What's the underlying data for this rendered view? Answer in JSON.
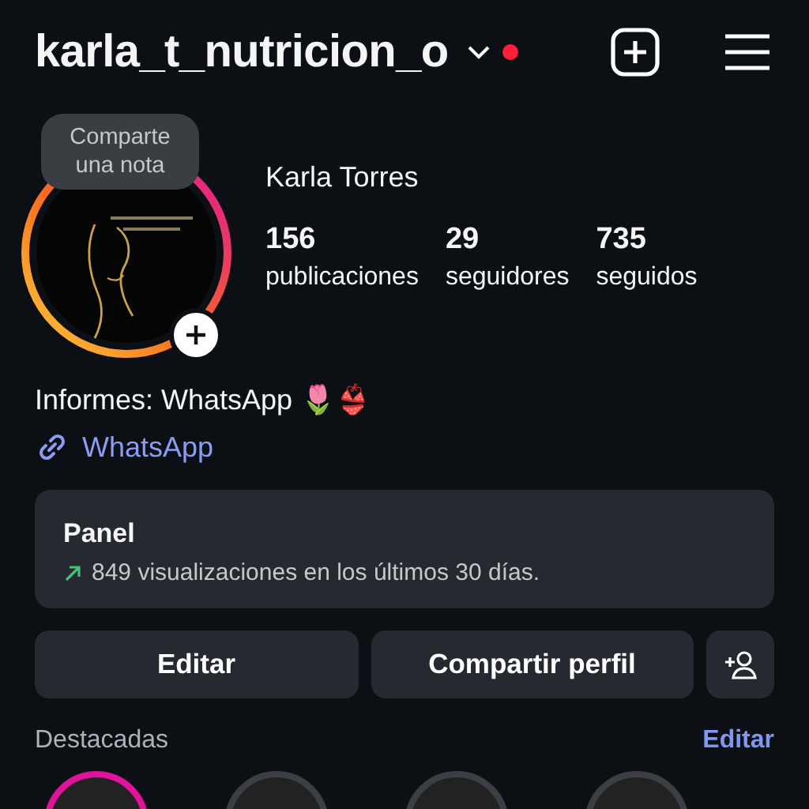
{
  "header": {
    "username": "karla_t_nutricion_o",
    "notification_dot": true
  },
  "profile": {
    "note_prompt": "Comparte una nota",
    "name": "Karla Torres",
    "stats": [
      {
        "count": "156",
        "label": "publicaciones"
      },
      {
        "count": "29",
        "label": "seguidores"
      },
      {
        "count": "735",
        "label": "seguidos"
      }
    ],
    "bio": "Informes: WhatsApp 🌷👙",
    "link": "WhatsApp"
  },
  "panel": {
    "title": "Panel",
    "subtitle": "849 visualizaciones en los últimos 30 días."
  },
  "buttons": [
    "Editar",
    "Compartir perfil"
  ],
  "highlights": {
    "title": "Destacadas",
    "action": "Editar",
    "items": [
      {
        "seen": false
      },
      {
        "seen": true
      },
      {
        "seen": true
      },
      {
        "seen": true
      }
    ]
  }
}
